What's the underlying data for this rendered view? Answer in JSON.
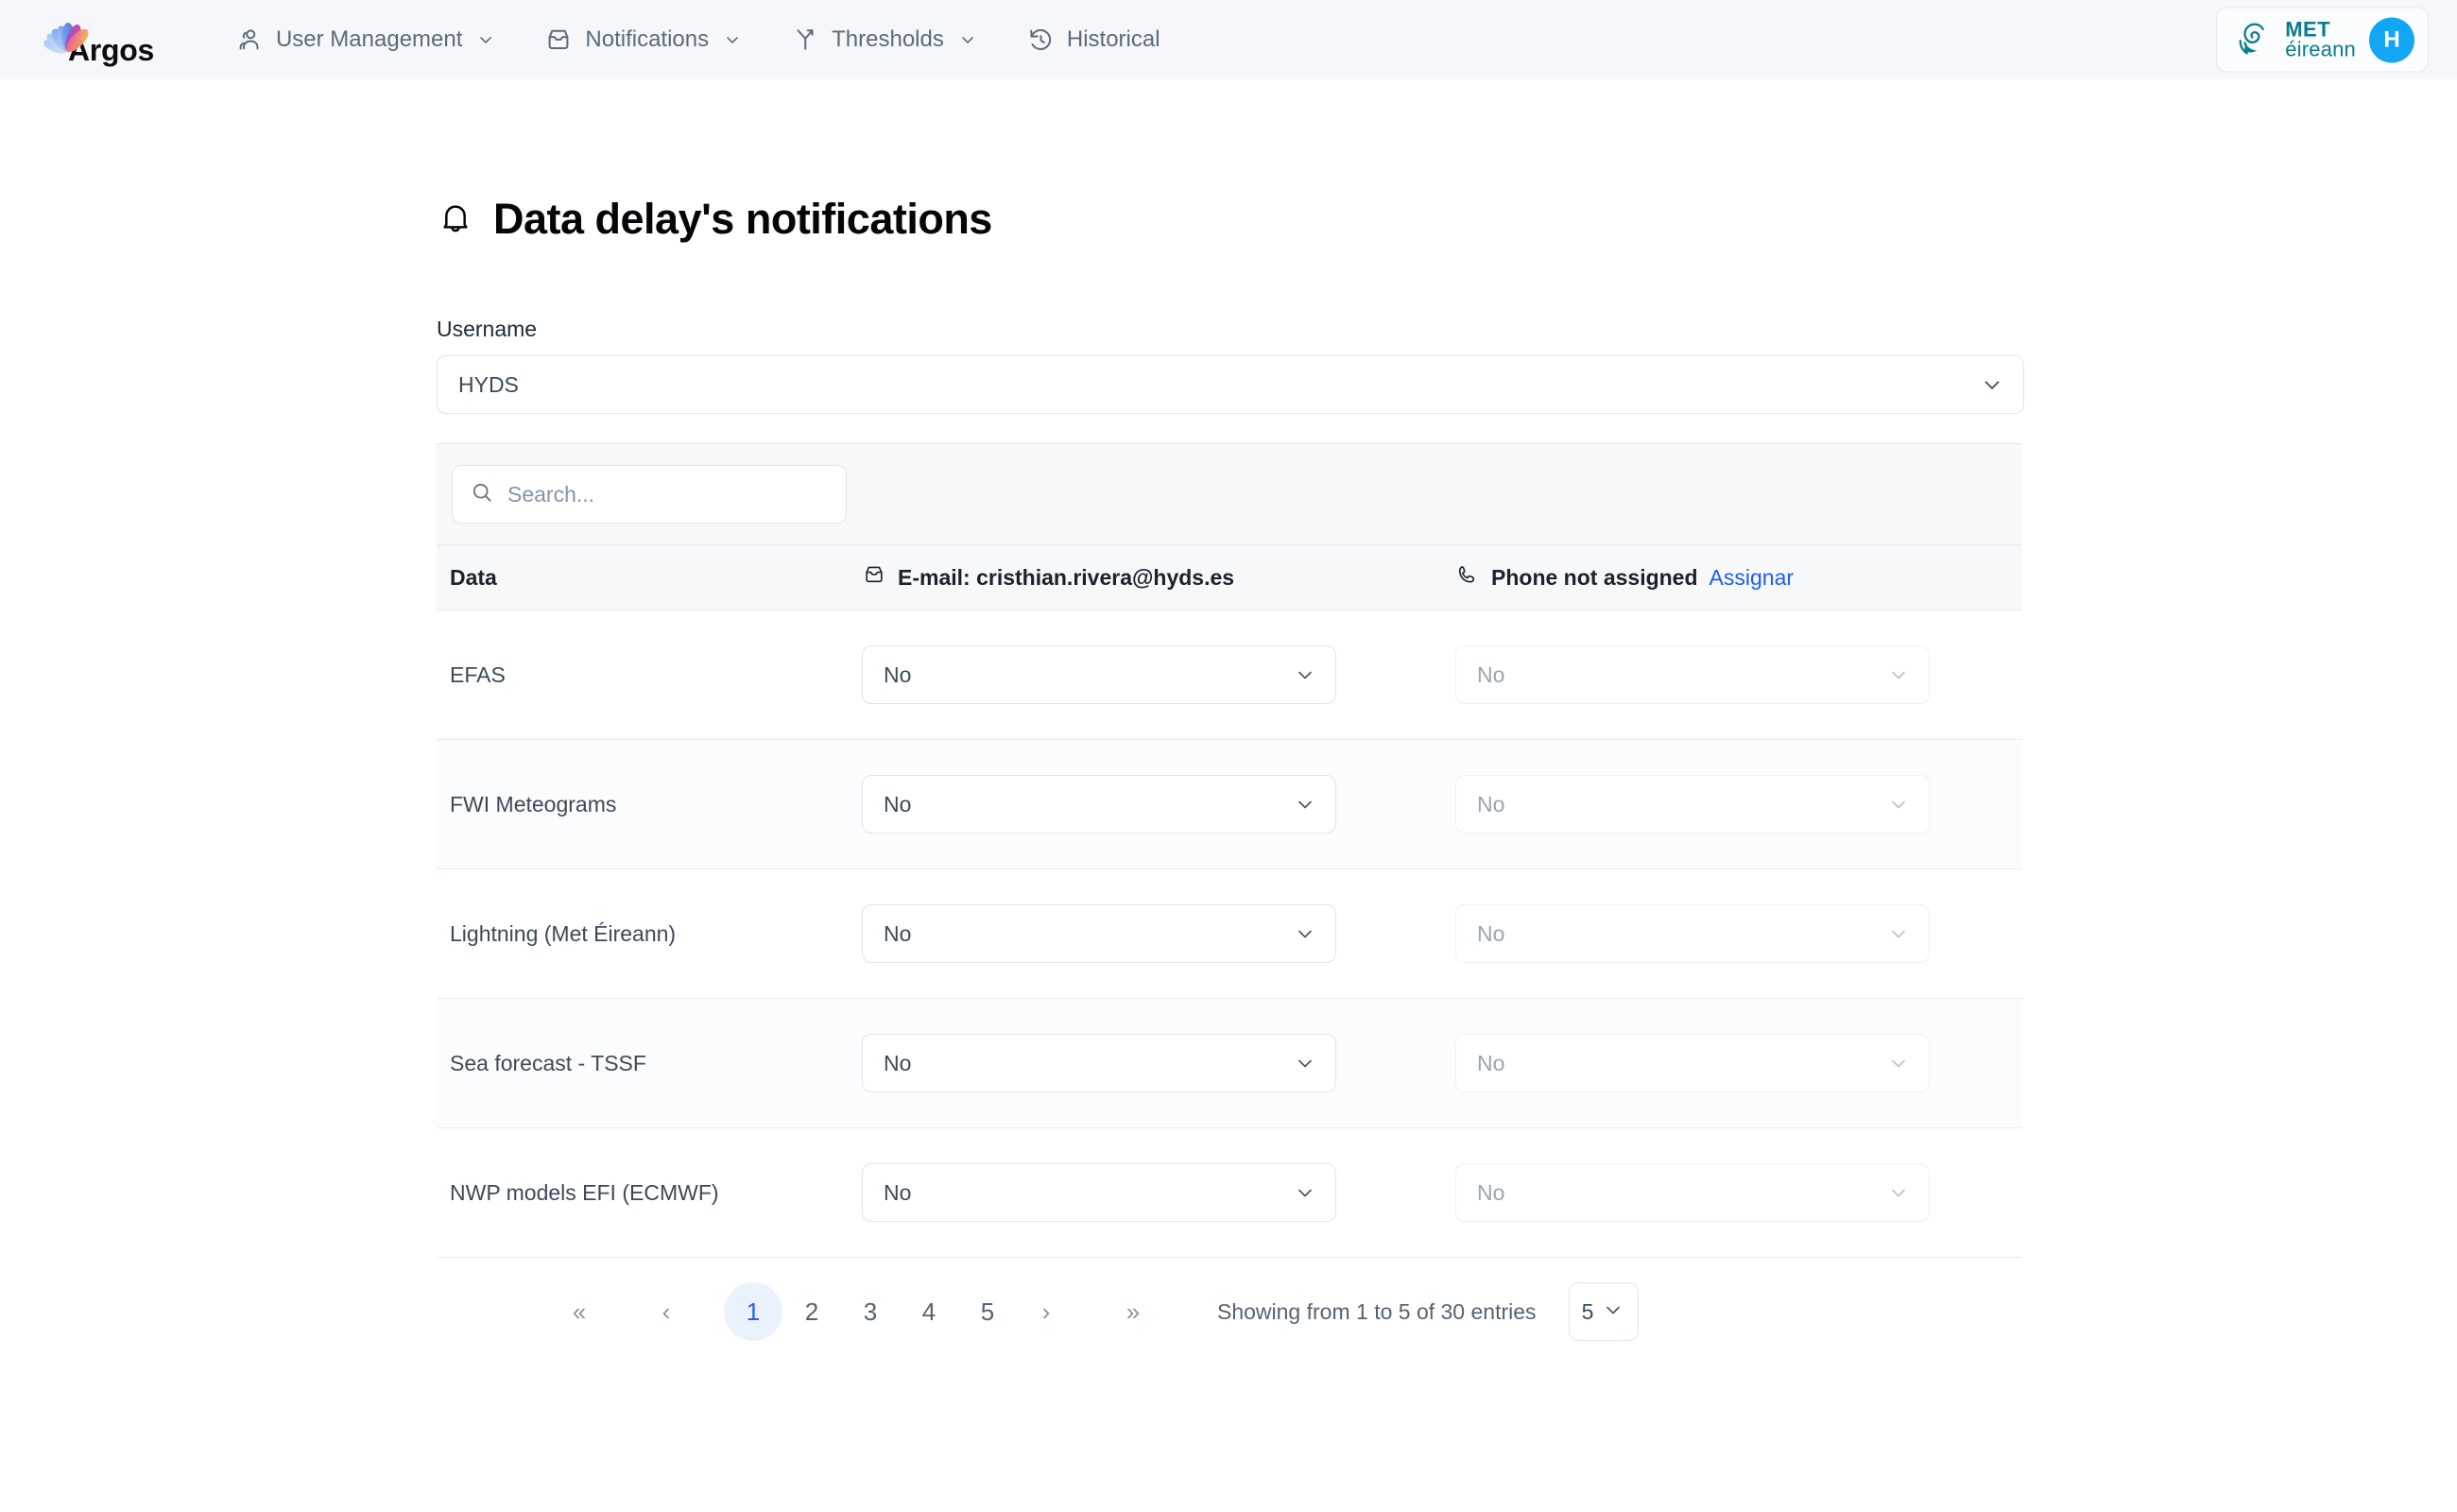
{
  "brand": {
    "name": "Argos"
  },
  "nav": {
    "items": [
      {
        "label": "User Management",
        "icon": "users-icon",
        "has_caret": true
      },
      {
        "label": "Notifications",
        "icon": "inbox-icon",
        "has_caret": true
      },
      {
        "label": "Thresholds",
        "icon": "filter-split-icon",
        "has_caret": true
      },
      {
        "label": "Historical",
        "icon": "history-icon",
        "has_caret": false
      }
    ]
  },
  "org_badge": {
    "logo_icon": "met-eireann-spiral-icon",
    "line1": "MET",
    "line2": "éireann",
    "logo_color": "#0a7c8c"
  },
  "avatar": {
    "initial": "H",
    "color": "#12a6f5"
  },
  "page": {
    "title": "Data delay's notifications",
    "title_icon": "bell-icon"
  },
  "username_field": {
    "label": "Username",
    "value": "HYDS",
    "icon": "chevron-down-icon"
  },
  "search": {
    "placeholder": "Search...",
    "value": "",
    "icon": "search-icon"
  },
  "table": {
    "columns": [
      {
        "key": "data",
        "label": "Data",
        "icon": null
      },
      {
        "key": "email",
        "label": "E-mail: cristhian.rivera@hyds.es",
        "icon": "inbox-icon"
      },
      {
        "key": "phone",
        "label": "Phone not assigned",
        "icon": "phone-icon",
        "link_label": "Assignar",
        "link_color": "#1f5bf5"
      }
    ],
    "rows": [
      {
        "data": "EFAS",
        "email": "No",
        "phone": "No",
        "phone_disabled": true
      },
      {
        "data": "FWI Meteograms",
        "email": "No",
        "phone": "No",
        "phone_disabled": true
      },
      {
        "data": "Lightning (Met Éireann)",
        "email": "No",
        "phone": "No",
        "phone_disabled": true
      },
      {
        "data": "Sea forecast - TSSF",
        "email": "No",
        "phone": "No",
        "phone_disabled": true
      },
      {
        "data": "NWP models EFI (ECMWF)",
        "email": "No",
        "phone": "No",
        "phone_disabled": true
      }
    ]
  },
  "pagination": {
    "first_label": "«",
    "prev_label": "‹",
    "pages": [
      "1",
      "2",
      "3",
      "4",
      "5"
    ],
    "active_page": "1",
    "next_label": "›",
    "last_label": "»",
    "showing_text": "Showing from 1 to 5 of 30 entries",
    "page_size": "5",
    "active_color": "#2b5df0",
    "active_bg": "#eaf2fe"
  }
}
